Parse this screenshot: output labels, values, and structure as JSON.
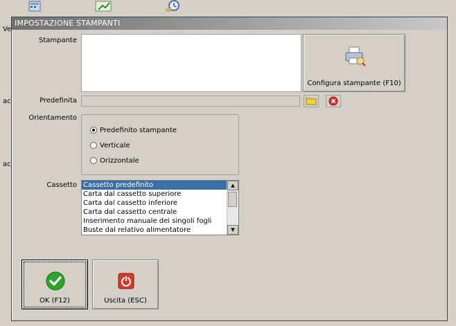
{
  "background": {
    "left_texts": [
      "Ve",
      "ac",
      "ac"
    ]
  },
  "dialog": {
    "title": "IMPOSTAZIONE STAMPANTI",
    "labels": {
      "printer": "Stampante",
      "default": "Predefinita",
      "orientation": "Orientamento",
      "tray": "Cassetto"
    },
    "configure_button": "Configura stampante (F10)",
    "default_value": "",
    "orientation_options": [
      {
        "label": "Predefinito stampante",
        "checked": true
      },
      {
        "label": "Verticale",
        "checked": false
      },
      {
        "label": "Orizzontale",
        "checked": false
      }
    ],
    "tray_options": [
      "Cassetto predefinito",
      "Carta dal cassetto superiore",
      "Carta dal cassetto inferiore",
      "Carta dal cassetto centrale",
      "Inserimento manuale dei singoli fogli",
      "Buste dal relativo alimentatore"
    ],
    "tray_selected_index": 0,
    "ok_button": "OK (F12)",
    "exit_button": "Uscita (ESC)"
  },
  "colors": {
    "selection": "#3a6ea5",
    "ok_green": "#2ea32e",
    "exit_red": "#d83a2a"
  }
}
